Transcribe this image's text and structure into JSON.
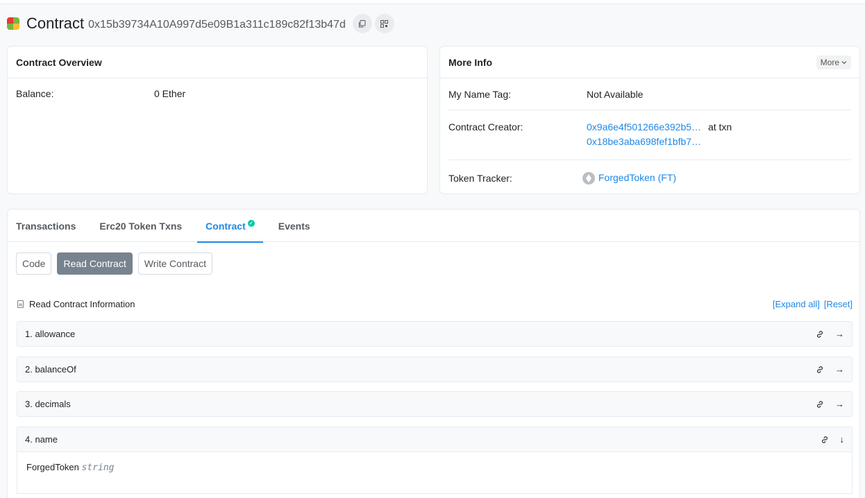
{
  "header": {
    "title": "Contract",
    "address": "0x15b39734A10A997d5e09B1a311c189c82f13b47d"
  },
  "overview": {
    "title": "Contract Overview",
    "balance_label": "Balance:",
    "balance_value": "0 Ether"
  },
  "more_info": {
    "title": "More Info",
    "more_button": "More",
    "name_tag_label": "My Name Tag:",
    "name_tag_value": "Not Available",
    "creator_label": "Contract Creator:",
    "creator_address": "0x9a6e4f501266e392b5…",
    "at_txn": "at txn",
    "creator_txn": "0x18be3aba698fef1bfb7…",
    "tracker_label": "Token Tracker:",
    "tracker_value": "ForgedToken (FT)"
  },
  "tabs": [
    "Transactions",
    "Erc20 Token Txns",
    "Contract",
    "Events"
  ],
  "subtabs": [
    "Code",
    "Read Contract",
    "Write Contract"
  ],
  "read_info": {
    "label": "Read Contract Information",
    "expand_all": "[Expand all]",
    "reset": "[Reset]"
  },
  "functions": [
    {
      "label": "1. allowance"
    },
    {
      "label": "2. balanceOf"
    },
    {
      "label": "3. decimals"
    },
    {
      "label": "4. name",
      "result": "ForgedToken",
      "result_type": "string"
    }
  ],
  "colors": {
    "link": "#1e88e5",
    "active_subtab": "#77838f",
    "verified": "#00c9a7"
  }
}
